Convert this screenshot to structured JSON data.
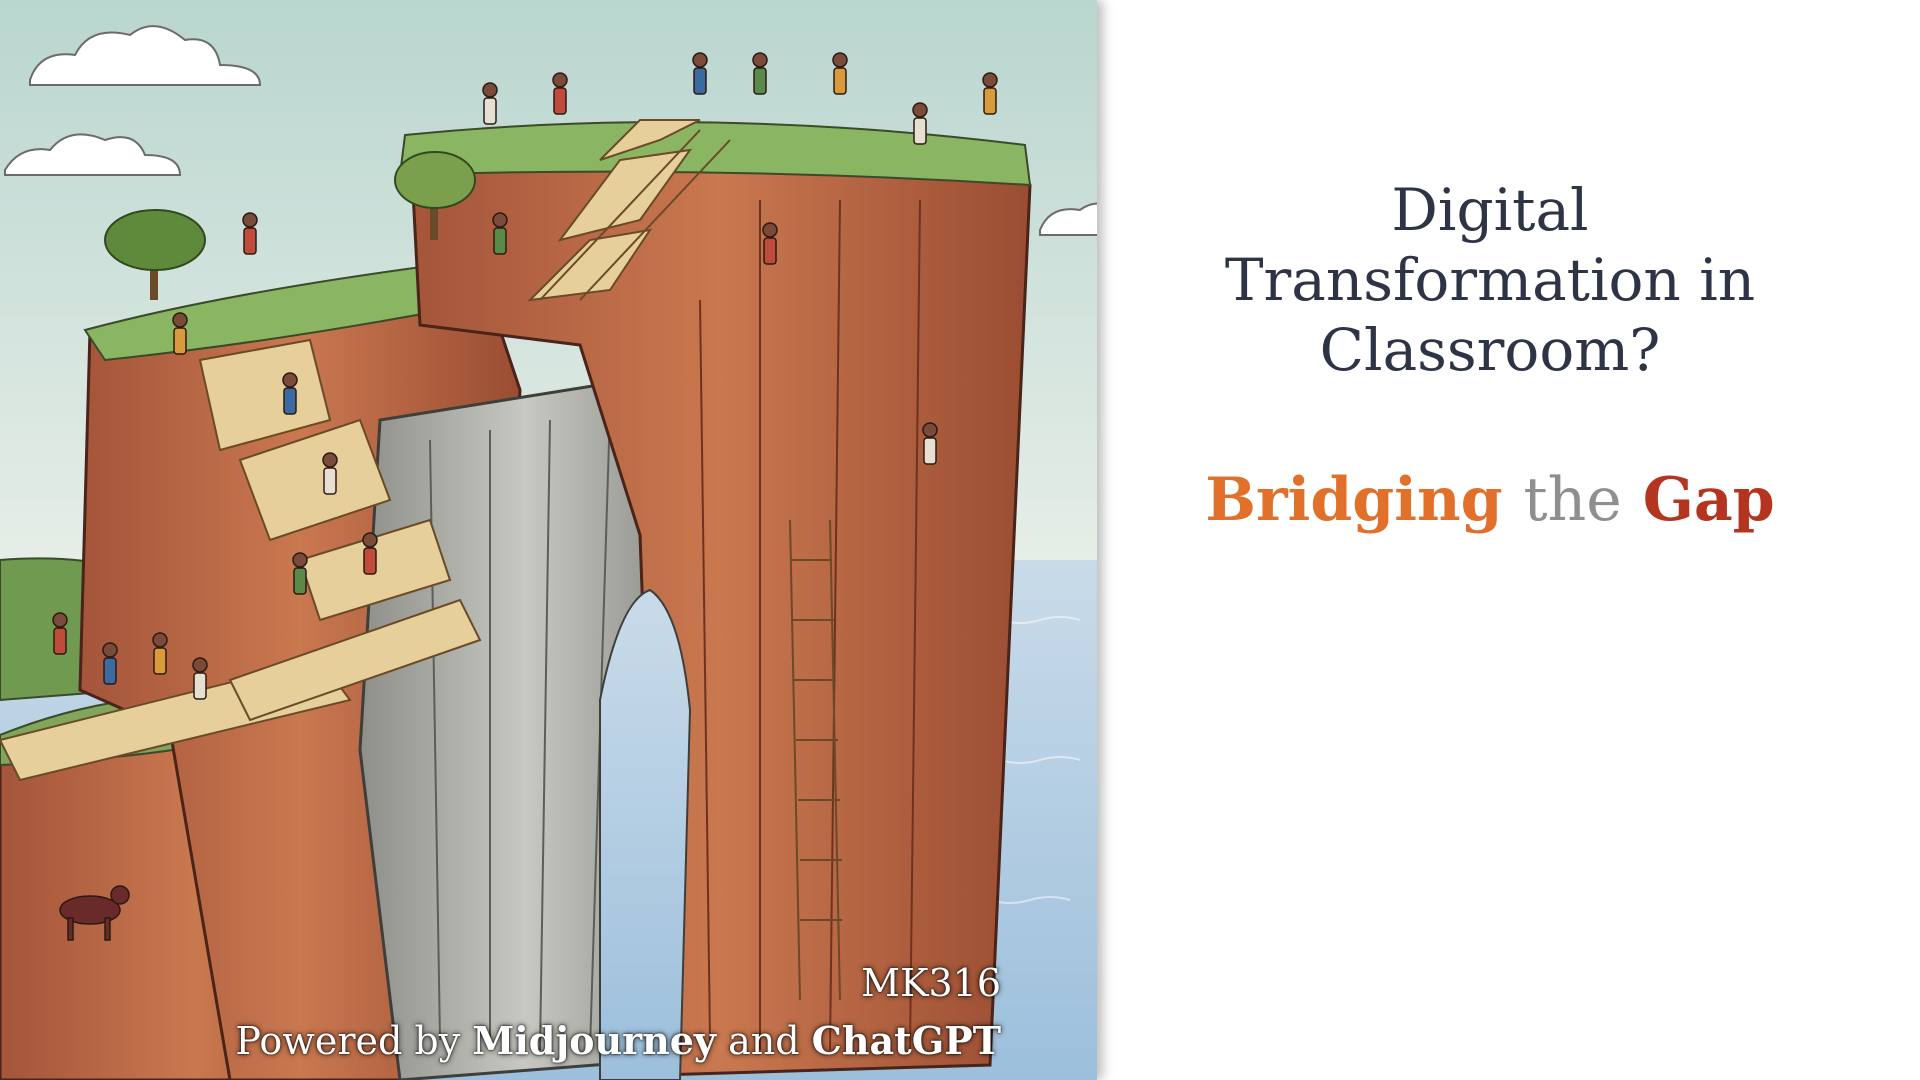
{
  "slide": {
    "title_lines": [
      "Digital",
      "Transformation in",
      "Classroom?"
    ],
    "subtitle": {
      "word1": "Bridging",
      "word2": "the",
      "word3": "Gap"
    },
    "caption": {
      "course": "MK316",
      "powered_prefix": "Powered by",
      "tool1": "Midjourney",
      "connector": "and",
      "tool2": "ChatGPT"
    },
    "colors": {
      "title": "#2e3445",
      "subtitle_word1": "#e0702a",
      "subtitle_word2": "#8f8f8f",
      "subtitle_word3": "#b5341f",
      "caption": "#ffffff"
    },
    "artwork": {
      "subject": "illustration-cliffs-with-wooden-stairs-and-people"
    }
  }
}
